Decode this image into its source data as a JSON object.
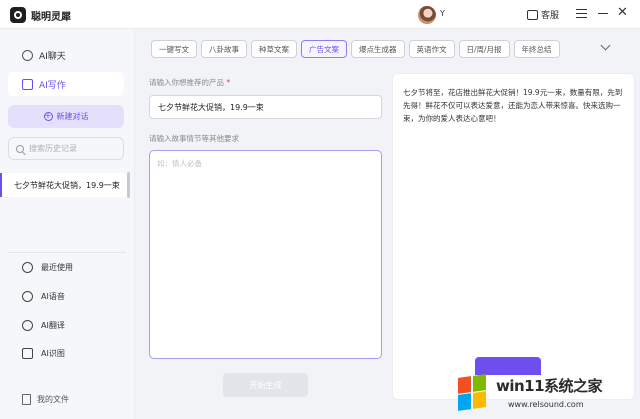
{
  "app": {
    "title": "聪明灵犀",
    "username": "Y"
  },
  "header": {
    "service_label": "客服"
  },
  "sidebar": {
    "chat_label": "AI聊天",
    "write_label": "AI写作",
    "new_chat_label": "新建对话",
    "search_placeholder": "搜索历史记录",
    "history": [
      "七夕节鲜花大促销，19.9一束"
    ],
    "tools": [
      "最近使用",
      "AI语音",
      "AI翻译",
      "AI识图"
    ],
    "footer_label": "我的文件"
  },
  "tabs": [
    "一键写文",
    "八卦故事",
    "种草文案",
    "广告文案",
    "爆点生成器",
    "英语作文",
    "日/周/月报",
    "年终总结"
  ],
  "active_tab": "广告文案",
  "form": {
    "product_label": "请输入你想推荐的产品",
    "required_mark": "*",
    "product_value": "七夕节鲜花大促销，19.9一束",
    "story_label": "请输入故事情节等其他要求",
    "story_placeholder": "如：情人必备",
    "generate_label": "开始生成"
  },
  "result": {
    "text": "七夕节将至，花店推出鲜花大促销！19.9元一束，数量有限，先到先得！鲜花不仅可以表达爱意，还能为恋人带来惊喜。快来选购一束，为你的爱人表达心意吧！"
  },
  "watermark": {
    "title": "win11系统之家",
    "url": "www.relsound.com"
  },
  "colors": {
    "accent": "#6d4ff0",
    "active_bg": "#e4dffa"
  }
}
